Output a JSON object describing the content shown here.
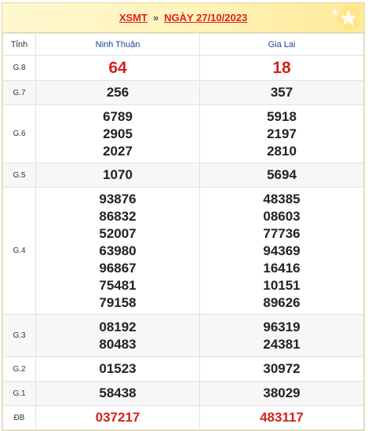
{
  "header": {
    "title": "XSMT",
    "separator": "»",
    "date_label": "NGÀY 27/10/2023"
  },
  "table": {
    "col_label": "Tỉnh",
    "provinces": [
      "Ninh Thuận",
      "Gia Lai"
    ],
    "rows": [
      {
        "label": "G.8",
        "values": [
          [
            "64"
          ],
          [
            "18"
          ]
        ]
      },
      {
        "label": "G.7",
        "values": [
          [
            "256"
          ],
          [
            "357"
          ]
        ]
      },
      {
        "label": "G.6",
        "values": [
          [
            "6789",
            "2905",
            "2027"
          ],
          [
            "5918",
            "2197",
            "2810"
          ]
        ]
      },
      {
        "label": "G.5",
        "values": [
          [
            "1070"
          ],
          [
            "5694"
          ]
        ]
      },
      {
        "label": "G.4",
        "values": [
          [
            "93876",
            "86832",
            "52007",
            "63980",
            "96867",
            "75481",
            "79158"
          ],
          [
            "48385",
            "08603",
            "77736",
            "94369",
            "16416",
            "10151",
            "89626"
          ]
        ]
      },
      {
        "label": "G.3",
        "values": [
          [
            "08192",
            "80483"
          ],
          [
            "96319",
            "24381"
          ]
        ]
      },
      {
        "label": "G.2",
        "values": [
          [
            "01523"
          ],
          [
            "30972"
          ]
        ]
      },
      {
        "label": "G.1",
        "values": [
          [
            "58438"
          ],
          [
            "38029"
          ]
        ]
      },
      {
        "label": "ĐB",
        "values": [
          [
            "037217"
          ],
          [
            "483117"
          ]
        ]
      }
    ]
  },
  "colors": {
    "accent_red": "#d4211c",
    "province_blue": "#1b3f9c",
    "header_bg": "#fff3b8"
  },
  "icons": {
    "header_decoration": "stars-icon"
  }
}
